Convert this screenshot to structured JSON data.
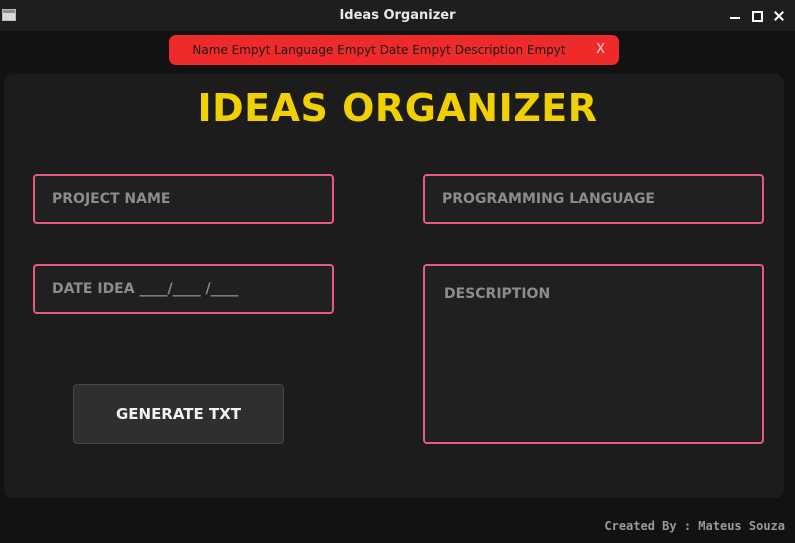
{
  "window": {
    "title": "Ideas Organizer"
  },
  "toast": {
    "message": "Name Empyt Language Empyt Date Empyt Description Empyt",
    "close_label": "X",
    "color": "#ee2a2a"
  },
  "app": {
    "heading": "IDEAS ORGANIZER",
    "heading_color": "#f0d000",
    "accent": "#ea5a7c"
  },
  "form": {
    "project_name_placeholder": "PROJECT NAME",
    "language_placeholder": "PROGRAMMING LANGUAGE",
    "date_placeholder": "DATE IDEA ____/____ /____",
    "description_placeholder": "DESCRIPTION",
    "generate_label": "GENERATE TXT"
  },
  "footer": {
    "credit": "Created By : Mateus Souza"
  }
}
